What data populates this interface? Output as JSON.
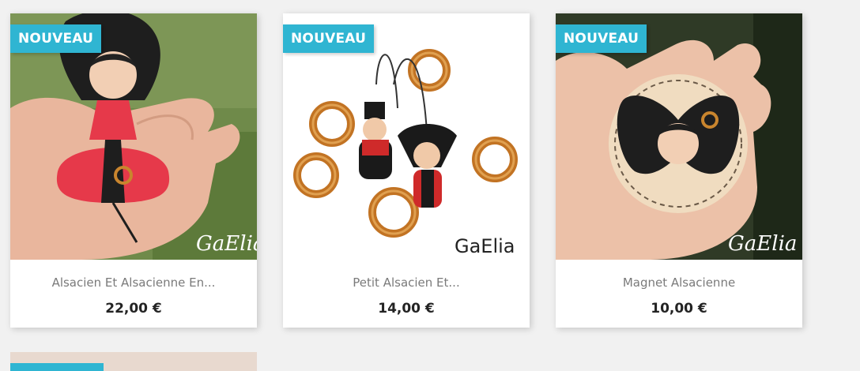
{
  "products": [
    {
      "badge": "NOUVEAU",
      "name": "Alsacien Et Alsacienne En...",
      "price": "22,00 €",
      "watermark": "GaElia"
    },
    {
      "badge": "NOUVEAU",
      "name": "Petit Alsacien Et...",
      "price": "14,00 €",
      "watermark": "GaElia"
    },
    {
      "badge": "NOUVEAU",
      "name": "Magnet Alsacienne",
      "price": "10,00 €",
      "watermark": "GaElia"
    }
  ],
  "colors": {
    "badge_bg": "#2fb5d2",
    "page_bg": "#f1f1f1",
    "price_text": "#232323",
    "name_text": "#7a7a7a"
  }
}
